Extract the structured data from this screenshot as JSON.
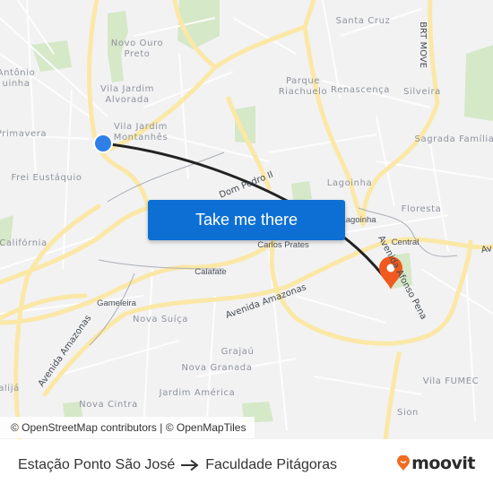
{
  "map": {
    "labels": {
      "novo_ouro_preto": "Novo Ouro\nPreto",
      "santo_antonio": "Antônio\nuinha",
      "vila_jardim_alvorada": "Vila Jardim\nAlvorada",
      "vila_jardim_montanhes": "Vila Jardim\nMontanhês",
      "primavera": "Primavera",
      "frei_eustaquio": "Frei Eustáquio",
      "santa_cruz": "Santa Cruz",
      "parque_riachuelo": "Parque\nRiachuelo",
      "renascenca": "Renascença",
      "silveira": "Silveira",
      "sagrada_familia": "Sagrada Família",
      "lagoinha": "Lagoinha",
      "lagoinha_station": "Lagoinha",
      "floresta": "Floresta",
      "central": "Central",
      "carlos_prates": "Carlos Prates",
      "calafate": "Calafate",
      "california": "Califórnia",
      "gameleira": "Gameleira",
      "nova_suica": "Nova Suíça",
      "grajau": "Grajaú",
      "nova_granada": "Nova Granada",
      "jardim_america": "Jardim América",
      "nova_cintra": "Nova Cintra",
      "vila_fumec": "Vila FUMEC",
      "sion": "Sion",
      "alija": "alijá"
    },
    "roads": {
      "brt_move": "BRT MOVE",
      "dom_pedro": "Dom Pedro II",
      "av_amazonas_center": "Avenida Amazonas",
      "av_amazonas_sw": "Avenida Amazonas",
      "av_afonso_pena": "Avenida Afonso Pena",
      "av_east": "Av"
    },
    "origin_marker": {
      "label": "Estação Ponto São José",
      "color": "#2f7fe8"
    },
    "destination_marker": {
      "label": "Faculdade Pitágoras",
      "color": "#f05a1e"
    },
    "route_color": "#222222",
    "cta_label": "Take me there",
    "attribution": "© OpenStreetMap contributors | © OpenMapTiles"
  },
  "footer": {
    "origin": "Estação Ponto São José",
    "destination": "Faculdade Pitágoras",
    "brand": "moovit",
    "brand_color": "#f26b21"
  }
}
